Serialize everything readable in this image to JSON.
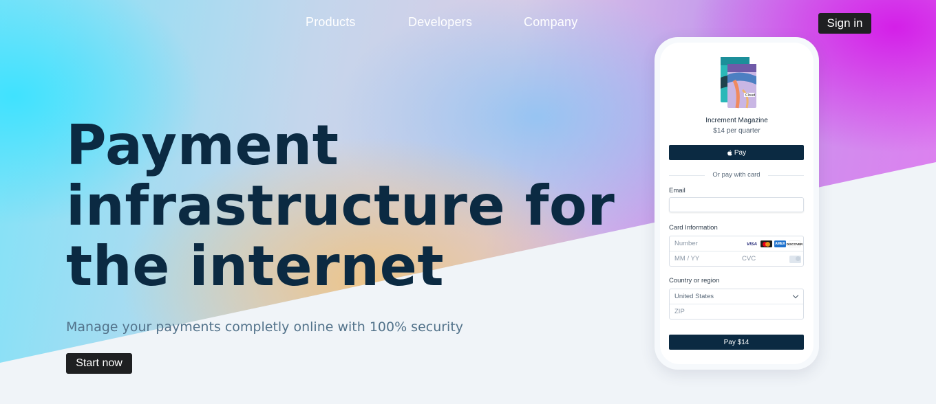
{
  "nav": {
    "items": [
      {
        "label": "Products"
      },
      {
        "label": "Developers"
      },
      {
        "label": "Company"
      }
    ],
    "sign_in_label": "Sign in"
  },
  "hero": {
    "headline_lines": [
      "Payment",
      "infrastructure for",
      "the internet"
    ],
    "subtitle": "Manage your payments completly online with 100% security",
    "cta_label": "Start now"
  },
  "checkout": {
    "product_name": "Increment Magazine",
    "product_price": "$14 per quarter",
    "apple_pay_label": "Pay",
    "divider_text": "Or pay with card",
    "email_label": "Email",
    "email_value": "",
    "card_label": "Card Information",
    "card_number_placeholder": "Number",
    "card_expiry_placeholder": "MM / YY",
    "card_cvc_placeholder": "CVC",
    "card_brands": [
      "VISA",
      "Mastercard",
      "AMEX",
      "DISCOVER"
    ],
    "country_label": "Country or region",
    "country_value": "United States",
    "zip_placeholder": "ZIP",
    "pay_button_label": "Pay $14"
  },
  "colors": {
    "dark_navy": "#0b2a42",
    "button_dark": "#1f2022",
    "subtitle": "#52728a",
    "page_bg": "#f0f4f8"
  },
  "icons": [
    "apple-icon",
    "visa-icon",
    "mastercard-icon",
    "amex-icon",
    "discover-icon",
    "cvc-card-icon",
    "chevron-down-icon",
    "magazine-cover-image"
  ]
}
